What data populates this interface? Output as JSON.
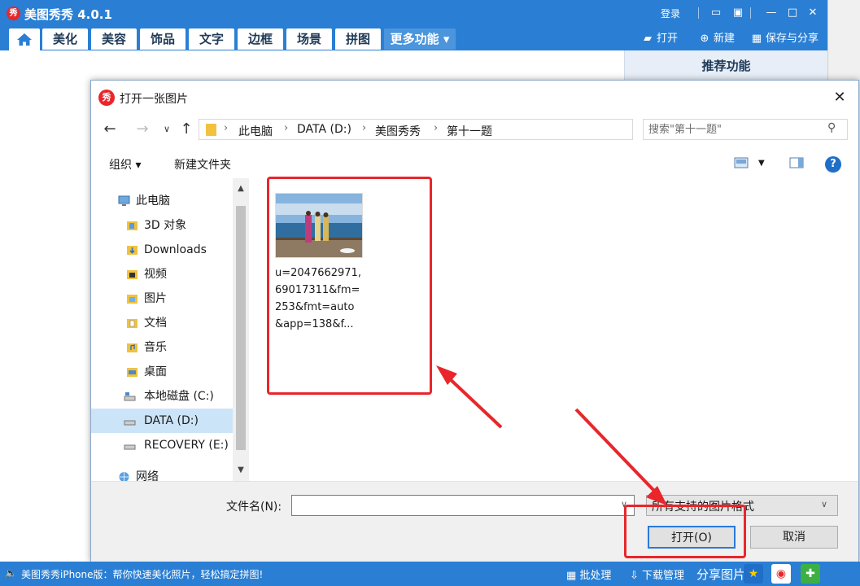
{
  "app": {
    "title": "美图秀秀 4.0.1",
    "logo_char": "秀",
    "login": "登录"
  },
  "nav": {
    "tabs": [
      "美化",
      "美容",
      "饰品",
      "文字",
      "边框",
      "场景",
      "拼图"
    ],
    "more": "更多功能 ▾",
    "open": "打开",
    "new": "新建",
    "save_share": "保存与分享"
  },
  "right_panel": {
    "title": "推荐功能"
  },
  "dialog": {
    "logo_char": "秀",
    "title": "打开一张图片",
    "breadcrumbs": [
      "此电脑",
      "DATA (D:)",
      "美图秀秀",
      "第十一题"
    ],
    "search_placeholder": "搜索\"第十一题\"",
    "organize": "组织 ▾",
    "new_folder": "新建文件夹",
    "help": "?",
    "tree": [
      {
        "label": "此电脑",
        "icon": "computer-icon"
      },
      {
        "label": "3D 对象",
        "icon": "folder-3d-icon"
      },
      {
        "label": "Downloads",
        "icon": "downloads-folder-icon"
      },
      {
        "label": "视频",
        "icon": "video-folder-icon"
      },
      {
        "label": "图片",
        "icon": "pictures-folder-icon"
      },
      {
        "label": "文档",
        "icon": "documents-folder-icon"
      },
      {
        "label": "音乐",
        "icon": "music-folder-icon"
      },
      {
        "label": "桌面",
        "icon": "desktop-folder-icon"
      },
      {
        "label": "本地磁盘 (C:)",
        "icon": "drive-c-icon"
      },
      {
        "label": "DATA (D:)",
        "icon": "drive-icon"
      },
      {
        "label": "RECOVERY (E:)",
        "icon": "drive-icon"
      },
      {
        "label": "网络",
        "icon": "network-icon"
      }
    ],
    "file": {
      "name_lines": [
        "u=2047662971,",
        "69017311&fm=",
        "253&fmt=auto",
        "&app=138&f..."
      ]
    },
    "filename_label": "文件名(N):",
    "filename_value": "",
    "filetype": "所有支持的图片格式",
    "open_btn": "打开(O)",
    "cancel_btn": "取消"
  },
  "statusbar": {
    "promo": "美图秀秀iPhone版：帮你快速美化照片，轻松搞定拼图!",
    "batch": "批处理",
    "download": "下载管理",
    "share": "分享图片"
  },
  "colors": {
    "accent": "#2a7fd4",
    "highlight": "#e8262b",
    "selected": "#cce4f7"
  }
}
